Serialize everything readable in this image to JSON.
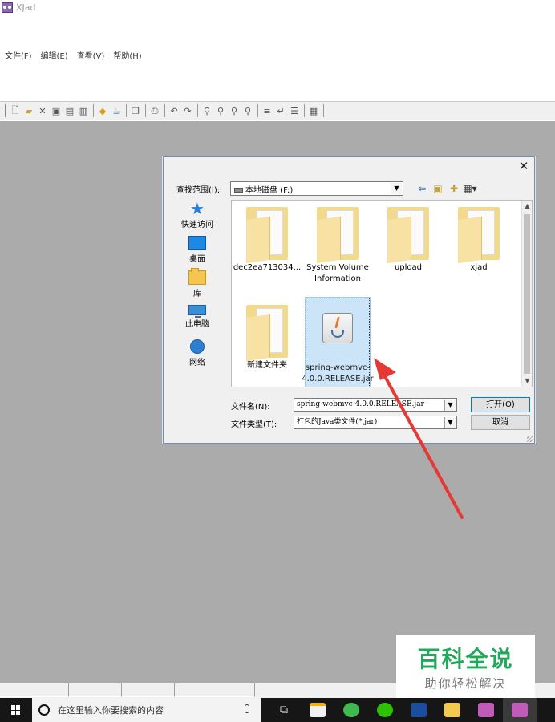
{
  "app": {
    "title": "XJad"
  },
  "menu": [
    "文件(F)",
    "编辑(E)",
    "查看(V)",
    "帮助(H)"
  ],
  "dialog": {
    "look_in_label": "查找范围(I):",
    "look_in_value": "本地磁盘 (F:)",
    "places": [
      {
        "label": "快速访问",
        "icon": "star-icon"
      },
      {
        "label": "桌面",
        "icon": "desktop-icon"
      },
      {
        "label": "库",
        "icon": "library-icon"
      },
      {
        "label": "此电脑",
        "icon": "computer-icon"
      },
      {
        "label": "网络",
        "icon": "network-icon"
      }
    ],
    "files": [
      {
        "label": "dec2ea713034...",
        "type": "folder"
      },
      {
        "label": "System Volume Information",
        "type": "folder"
      },
      {
        "label": "upload",
        "type": "folder"
      },
      {
        "label": "xjad",
        "type": "folder"
      },
      {
        "label": "新建文件夹",
        "type": "folder"
      },
      {
        "label": "spring-webmvc-4.0.0.RELEASE.jar",
        "type": "jar",
        "selected": true
      }
    ],
    "file_name_label": "文件名(N):",
    "file_name_value": "spring-webmvc-4.0.0.RELEASE.jar",
    "file_type_label": "文件类型(T):",
    "file_type_value": "打包的Java类文件(*.jar)",
    "open_label": "打开(O)",
    "cancel_label": "取消"
  },
  "watermark": {
    "title": "百科全说",
    "subtitle": "助你轻松解决"
  },
  "taskbar": {
    "search_placeholder": "在这里输入你要搜索的内容"
  },
  "colors": {
    "accent": "#0078d7",
    "arrow": "#e53935",
    "watermark": "#21a95a",
    "selection": "#cce4f7",
    "workspace": "#ababab"
  }
}
